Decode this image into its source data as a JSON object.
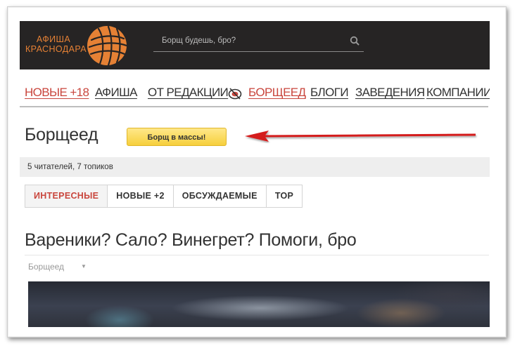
{
  "header": {
    "logo_line1": "АФИША",
    "logo_line2": "КРАСНОДАРА",
    "search_placeholder": "Борщ будешь, бро?",
    "logo_icon": "yarn-ball-icon",
    "search_icon": "search-icon"
  },
  "nav": {
    "items": [
      {
        "label": "НОВЫЕ +18",
        "highlight": true
      },
      {
        "label": "АФИША",
        "highlight": false
      },
      {
        "label": "ОТ РЕДАКЦИИ",
        "highlight": false
      },
      {
        "label": "БОРЩЕЕД",
        "highlight": true,
        "icon": "plate-icon"
      },
      {
        "label": "БЛОГИ",
        "highlight": false
      },
      {
        "label": "ЗАВЕДЕНИЯ",
        "highlight": false
      },
      {
        "label": "КОМПАНИИ",
        "highlight": false
      }
    ]
  },
  "blog": {
    "title": "Борщеед",
    "join_button": "Борщ в массы!",
    "stats": "5 читателей, 7 топиков"
  },
  "tabs": [
    {
      "label": "ИНТЕРЕСНЫЕ",
      "active": true
    },
    {
      "label": "НОВЫЕ +2",
      "active": false
    },
    {
      "label": "ОБСУЖДАЕМЫЕ",
      "active": false
    },
    {
      "label": "TOP",
      "active": false
    }
  ],
  "topic": {
    "title": "Вареники? Сало? Винегрет? Помоги, бро",
    "blog_name": "Борщеед"
  },
  "colors": {
    "header_bg": "#262424",
    "logo_orange": "#e58135",
    "accent_red": "#c9463d",
    "button_yellow": "#f6cf3c",
    "annotation_arrow": "#d41e1e"
  }
}
